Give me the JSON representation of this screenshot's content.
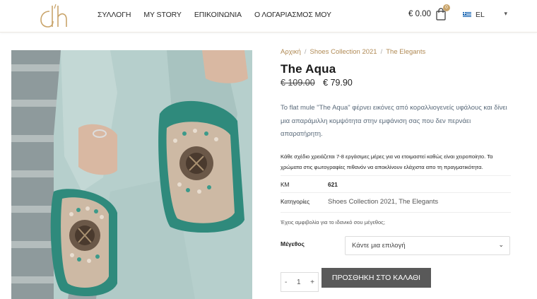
{
  "brand": {
    "logo_text": "dh"
  },
  "nav": {
    "items": [
      "ΣΥΛΛΟΓΗ",
      "MY STORY",
      "ΕΠΙΚΟΙΝΩΝΙΑ",
      "Ο ΛΟΓΑΡΙΑΣΜΟΣ ΜΟΥ"
    ]
  },
  "cart": {
    "total": "€ 0.00",
    "count": "0",
    "icon": "shopping-bag-icon"
  },
  "language": {
    "selected": "EL",
    "flag": "greece-flag-icon"
  },
  "breadcrumb": [
    "Αρχική",
    "Shoes Collection 2021",
    "The Elegants"
  ],
  "product": {
    "title": "The Aqua",
    "price_old": "€ 109.00",
    "price_new": "€ 79.90",
    "description": "Το flat mule \"The Aqua\" φέρνει εικόνες από κοραλλιογενείς υφάλους και δίνει μια απαράμιλλη κομψότητα στην εμφάνιση σας που δεν περνάει απαρατήρητη.",
    "note": "Κάθε σχέδιο χρειάζεται 7-8 εργάσιμες μέρες για να ετοιμαστεί καθώς είναι χειροποίητο. Τα χρώματα στις φωτογραφίες πιθανόν να αποκλίνουν ελάχιστα απο τη πραγματικότητα.",
    "meta": {
      "sku_label": "ΚΜ",
      "sku_value": "621",
      "categories_label": "Κατηγορίες",
      "categories": [
        "Shoes Collection 2021",
        "The Elegants"
      ]
    },
    "size_hint": "Έχεις αμφιβολία για το ιδανικό σου μέγεθος;",
    "size_label": "Μέγεθος",
    "size_placeholder": "Κάντε μια επιλογή",
    "quantity": "1",
    "qty_minus": "-",
    "qty_plus": "+",
    "add_to_cart": "ΠΡΟΣΘΗΚΗ ΣΤΟ ΚΑΛΑΘΙ"
  },
  "colors": {
    "accent": "#c9a46a",
    "button": "#595959",
    "link": "#b08a55"
  }
}
